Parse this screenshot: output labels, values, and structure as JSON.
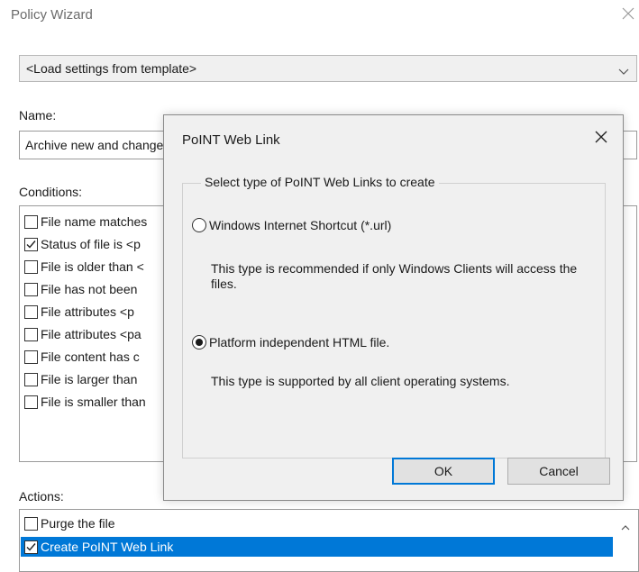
{
  "wizard": {
    "title": "Policy Wizard",
    "template_select": "<Load settings from template>",
    "name_label": "Name:",
    "name_value": "Archive new and changed files",
    "conditions_label": "Conditions:",
    "conditions": [
      {
        "label": "File name matches",
        "checked": false
      },
      {
        "label": "Status of file is <p",
        "checked": true
      },
      {
        "label": "File is older than <",
        "checked": false
      },
      {
        "label": "File has not been",
        "checked": false
      },
      {
        "label": "File attributes <p",
        "checked": false
      },
      {
        "label": "File attributes <pa",
        "checked": false
      },
      {
        "label": "File content has c",
        "checked": false
      },
      {
        "label": "File is larger than",
        "checked": false
      },
      {
        "label": "File is smaller than",
        "checked": false
      }
    ],
    "actions_label": "Actions:",
    "actions": [
      {
        "label": "Purge the file",
        "checked": false,
        "selected": false
      },
      {
        "label": "Create PoINT Web Link",
        "checked": true,
        "selected": true
      }
    ]
  },
  "dialog": {
    "title": "PoINT Web Link",
    "group_label": "Select type of PoINT Web Links to create",
    "options": [
      {
        "label": "Windows Internet Shortcut (*.url)",
        "selected": false,
        "description": "This type is recommended if only Windows Clients will access the files."
      },
      {
        "label": "Platform independent HTML file.",
        "selected": true,
        "description": "This type is supported by all client operating systems."
      }
    ],
    "ok_label": "OK",
    "cancel_label": "Cancel"
  },
  "icons": {
    "close": "close-icon",
    "chevron": "chevron-down-icon",
    "scroll_up": "scroll-up-arrow-icon"
  },
  "colors": {
    "selection": "#0078d7",
    "dialog_bg": "#f0f0f0"
  }
}
